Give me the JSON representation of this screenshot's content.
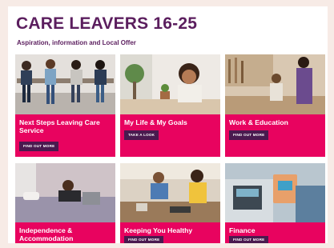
{
  "header": {
    "title": "CARE LEAVERS 16-25",
    "subtitle": "Aspiration, information and Local Offer"
  },
  "tiles": [
    {
      "title": "Next Steps Leaving Care Service",
      "cta": "FIND OUT MORE",
      "image": "young-people-seated-photo"
    },
    {
      "title": "My Life & My Goals",
      "cta": "TAKE A LOOK",
      "image": "woman-thinking-photo"
    },
    {
      "title": "Work & Education",
      "cta": "FIND OUT MORE",
      "image": "workshop-colleagues-photo"
    },
    {
      "title": "Independence & Accommodation",
      "cta": "",
      "image": "young-man-laptop-bed-photo"
    },
    {
      "title": "Keeping You Healthy",
      "cta": "FIND OUT MORE",
      "image": "couple-cooking-photo"
    },
    {
      "title": "Finance",
      "cta": "FIND OUT MORE",
      "image": "card-payment-photo"
    }
  ],
  "colors": {
    "page_bg": "#f7ebe6",
    "title": "#5b1e5e",
    "band": "#e8035f",
    "button": "#4a1a4f"
  }
}
